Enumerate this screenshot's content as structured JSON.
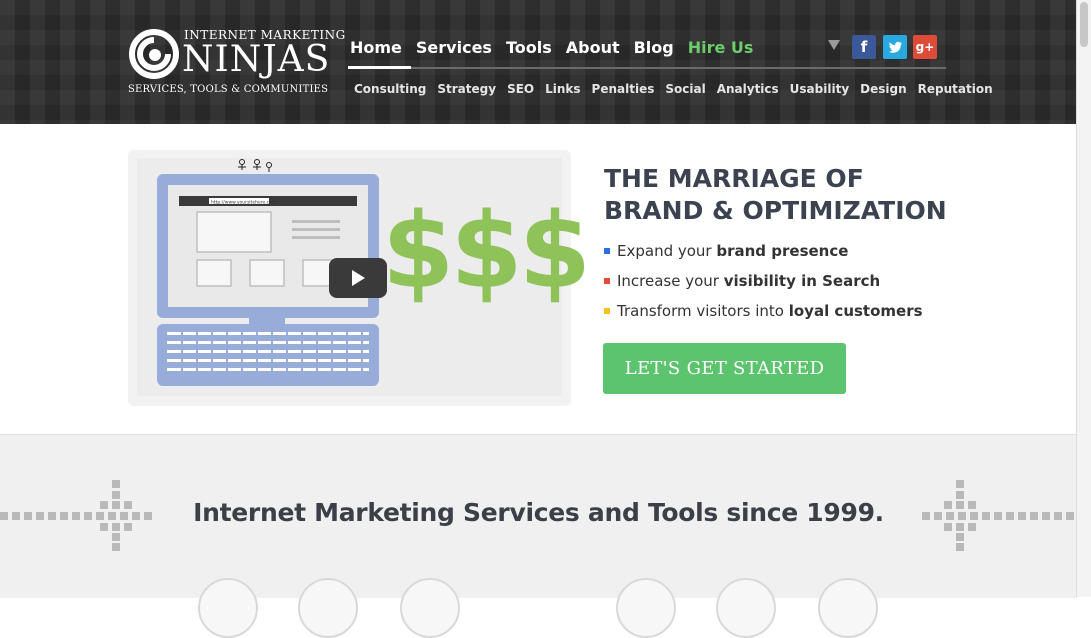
{
  "header": {
    "logo": {
      "top_text": "INTERNET MARKETING",
      "brand": "NINJAS",
      "sub_text": "SERVICES, TOOLS & COMMUNITIES"
    },
    "main_nav": [
      {
        "label": "Home",
        "active": true
      },
      {
        "label": "Services"
      },
      {
        "label": "Tools"
      },
      {
        "label": "About"
      },
      {
        "label": "Blog"
      },
      {
        "label": "Hire Us"
      }
    ],
    "sub_nav": [
      "Consulting",
      "Strategy",
      "SEO",
      "Links",
      "Penalties",
      "Social",
      "Analytics",
      "Usability",
      "Design",
      "Reputation"
    ],
    "social": {
      "facebook": "f",
      "twitter": "twitter-icon",
      "google_plus": "g+"
    }
  },
  "hero": {
    "video": {
      "dollar_text": "$$$",
      "url_bar": "http://www.yoursitehere.com"
    },
    "title": "THE MARRIAGE OF\nBRAND & OPTIMIZATION",
    "bullets": [
      {
        "prefix": "Expand your ",
        "bold": "brand presence",
        "color": "#2a6ee0"
      },
      {
        "prefix": "Increase your ",
        "bold": "visibility in Search",
        "color": "#e34a3a"
      },
      {
        "prefix": "Transform visitors into ",
        "bold": "loyal customers",
        "color": "#f2c226"
      }
    ],
    "cta_label": "LET'S GET STARTED"
  },
  "section": {
    "title": "Internet Marketing Services and Tools since 1999."
  },
  "colors": {
    "accent_green": "#5cc46e",
    "hire_us_green": "#6ccb6c",
    "header_dark": "#2e2e2e",
    "dollar_green": "#8fc35a"
  }
}
